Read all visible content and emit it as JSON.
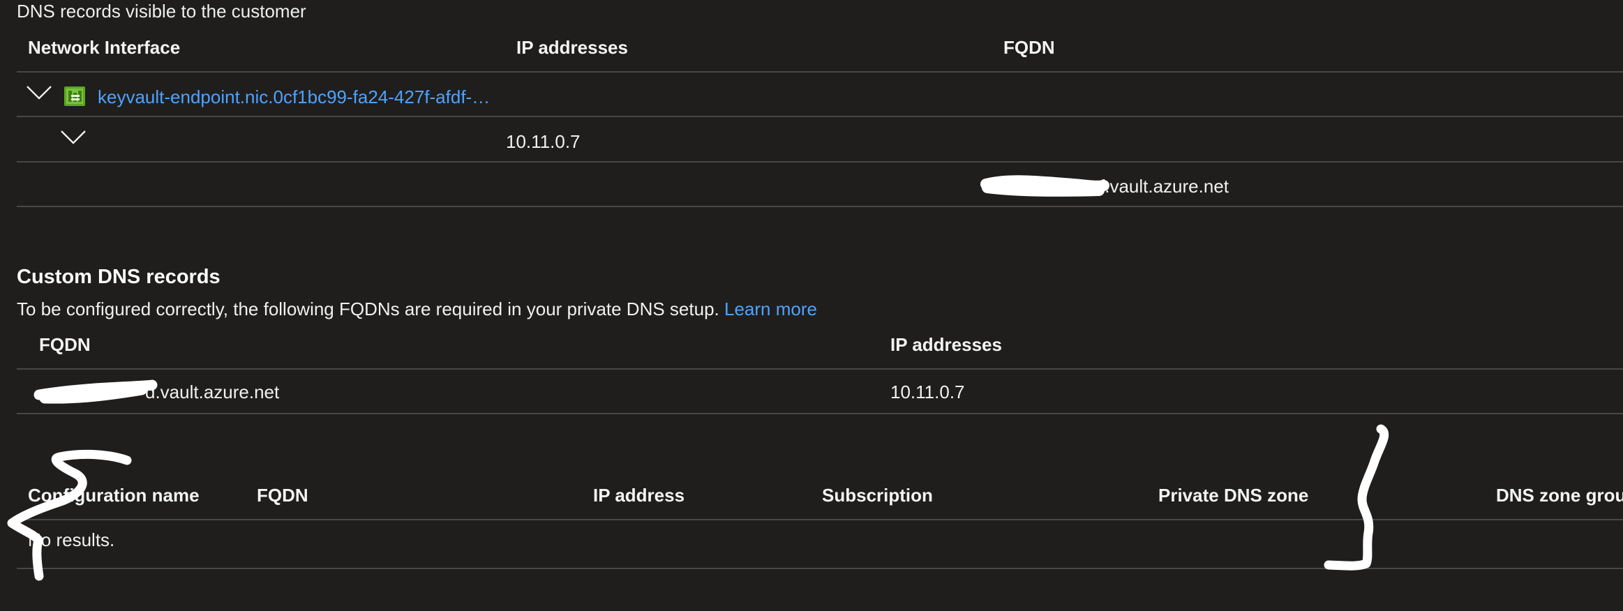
{
  "dns_records": {
    "caption": "DNS records visible to the customer",
    "columns": {
      "network_interface": "Network Interface",
      "ip_addresses": "IP addresses",
      "fqdn": "FQDN"
    },
    "nic_row": {
      "name": "keyvault-endpoint.nic.0cf1bc99-fa24-427f-afdf-…",
      "expand_icon": "chevron-down-icon",
      "resource_icon": "network-interface-icon"
    },
    "ip_row": {
      "ip": "10.11.0.7",
      "expand_icon": "chevron-down-icon"
    },
    "fqdn_row": {
      "fqdn_visible_part": "f.vault.azure.net"
    }
  },
  "custom_dns": {
    "title": "Custom DNS records",
    "description": "To be configured correctly, the following FQDNs are required in your private DNS setup.",
    "learn_more": "Learn more",
    "columns": {
      "fqdn": "FQDN",
      "ip_addresses": "IP addresses"
    },
    "rows": [
      {
        "fqdn_visible_part": "d.vault.azure.net",
        "ip": "10.11.0.7"
      }
    ]
  },
  "config_table": {
    "columns": {
      "configuration_name": "Configuration name",
      "fqdn": "FQDN",
      "ip_address": "IP address",
      "subscription": "Subscription",
      "private_dns_zone": "Private DNS zone",
      "dns_zone_group": "DNS zone grou"
    },
    "empty_text": "No results."
  },
  "colors": {
    "background": "#1f1e1d",
    "text": "#f2f2f2",
    "link": "#4da3ff",
    "divider": "#494746",
    "icon_green": "#5ea721"
  }
}
